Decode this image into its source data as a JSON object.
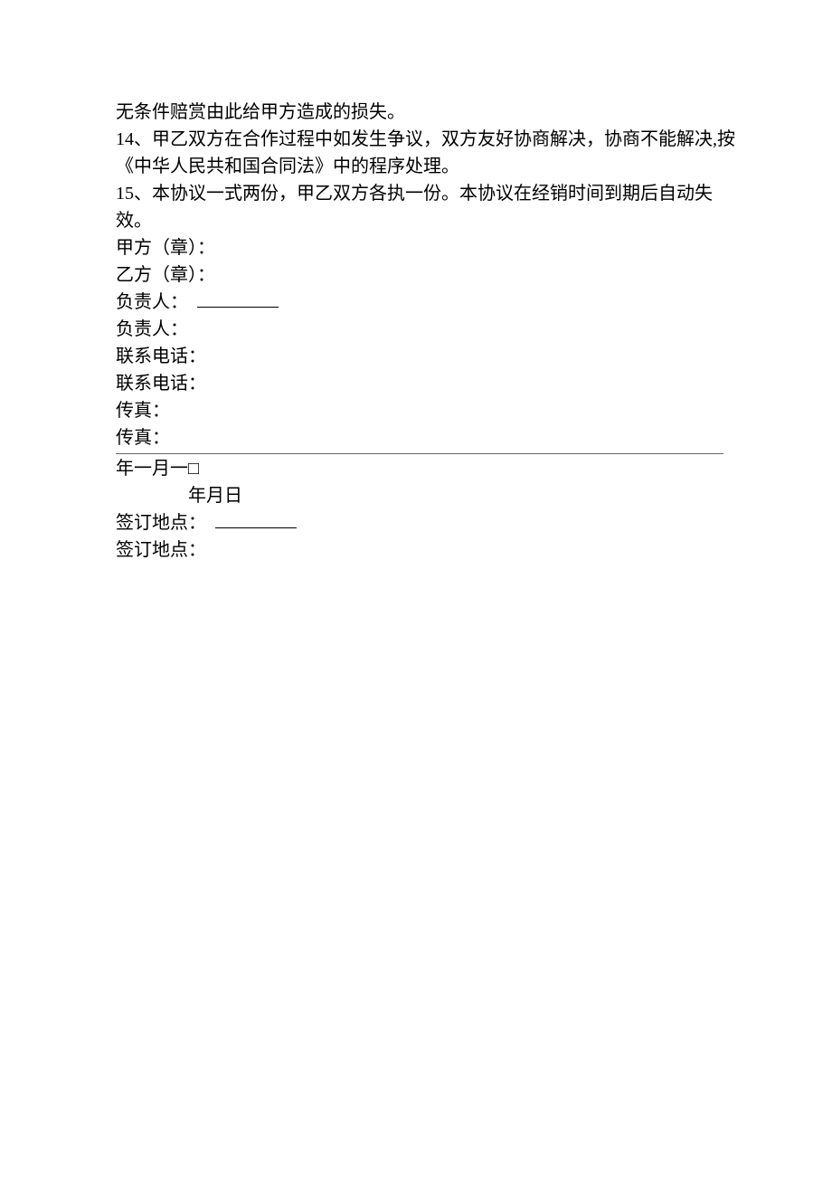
{
  "lines": {
    "l1": "无条件赔赏由此给甲方造成的损失。",
    "l2": "14、甲乙双方在合作过程中如发生争议，双方友好协商解决，协商不能解决,按",
    "l3": "《中华人民共和国合同法》中的程序处理。",
    "l4": "15、本协议一式两份，甲乙双方各执一份。本协议在经销时间到期后自动失",
    "l5": "效。",
    "l6": "甲方（章）：",
    "l7": "乙方（章）：",
    "l8a": "负责人：",
    "l9": "负责人：",
    "l10": "联系电话：",
    "l11": "联系电话：",
    "l12": "传真：",
    "l13": "传真：",
    "l14": "年一月一□",
    "l15": "年月日",
    "l16a": "签订地点：",
    "l17": "签订地点："
  }
}
